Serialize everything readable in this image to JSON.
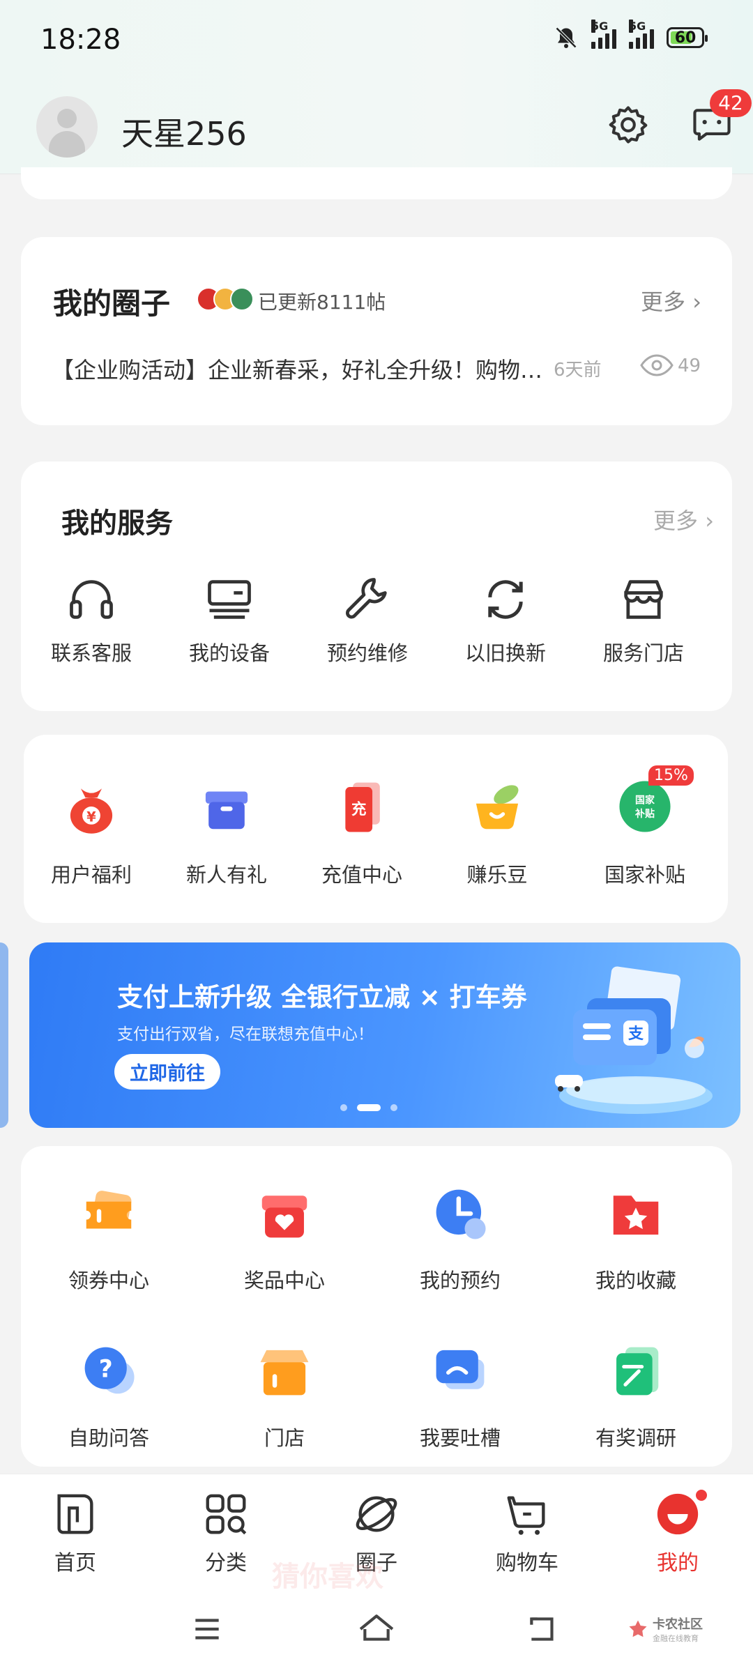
{
  "status_bar": {
    "time": "18:28",
    "network1": "5G",
    "network2": "5G",
    "battery": "60"
  },
  "header": {
    "username": "天星256",
    "message_badge": "42"
  },
  "circle": {
    "title": "我的圈子",
    "updated": "已更新8111帖",
    "more": "更多",
    "post": "【企业购活动】企业新春采，好礼全升级！购物满额赠好礼",
    "time": "6天前",
    "views": "49"
  },
  "services": {
    "title": "我的服务",
    "more": "更多",
    "items": [
      {
        "label": "联系客服",
        "icon": "headset-icon"
      },
      {
        "label": "我的设备",
        "icon": "device-icon"
      },
      {
        "label": "预约维修",
        "icon": "wrench-icon"
      },
      {
        "label": "以旧换新",
        "icon": "refresh-icon"
      },
      {
        "label": "服务门店",
        "icon": "store-icon"
      }
    ]
  },
  "perks": {
    "items": [
      {
        "label": "用户福利",
        "icon": "money-bag-icon"
      },
      {
        "label": "新人有礼",
        "icon": "gift-box-icon"
      },
      {
        "label": "充值中心",
        "icon": "recharge-icon",
        "icon_text": "充"
      },
      {
        "label": "赚乐豆",
        "icon": "bean-pot-icon"
      },
      {
        "label": "国家补贴",
        "icon": "subsidy-icon",
        "icon_text": "国家补贴",
        "badge": "15%"
      }
    ]
  },
  "banner": {
    "title": "支付上新升级 全银行立减 × 打车券",
    "subtitle": "支付出行双省，尽在联想充值中心！",
    "button": "立即前往"
  },
  "grid": {
    "items": [
      {
        "label": "领券中心",
        "icon": "coupon-icon"
      },
      {
        "label": "奖品中心",
        "icon": "prize-icon"
      },
      {
        "label": "我的预约",
        "icon": "clock-icon"
      },
      {
        "label": "我的收藏",
        "icon": "star-folder-icon"
      },
      {
        "label": "自助问答",
        "icon": "question-bubble-icon"
      },
      {
        "label": "门店",
        "icon": "shop-icon"
      },
      {
        "label": "我要吐槽",
        "icon": "feedback-bubble-icon"
      },
      {
        "label": "有奖调研",
        "icon": "survey-icon"
      }
    ]
  },
  "tabbar": {
    "items": [
      {
        "label": "首页",
        "icon": "home-icon"
      },
      {
        "label": "分类",
        "icon": "category-icon"
      },
      {
        "label": "圈子",
        "icon": "planet-icon"
      },
      {
        "label": "购物车",
        "icon": "cart-icon"
      },
      {
        "label": "我的",
        "icon": "profile-icon"
      }
    ],
    "faded_text": "猜你喜欢"
  },
  "watermark": {
    "title": "卡农社区",
    "subtitle": "金融在线教育"
  },
  "colors": {
    "accent": "#e8332f",
    "badge": "#ef3b3b",
    "banner": "#2f7bf5"
  }
}
